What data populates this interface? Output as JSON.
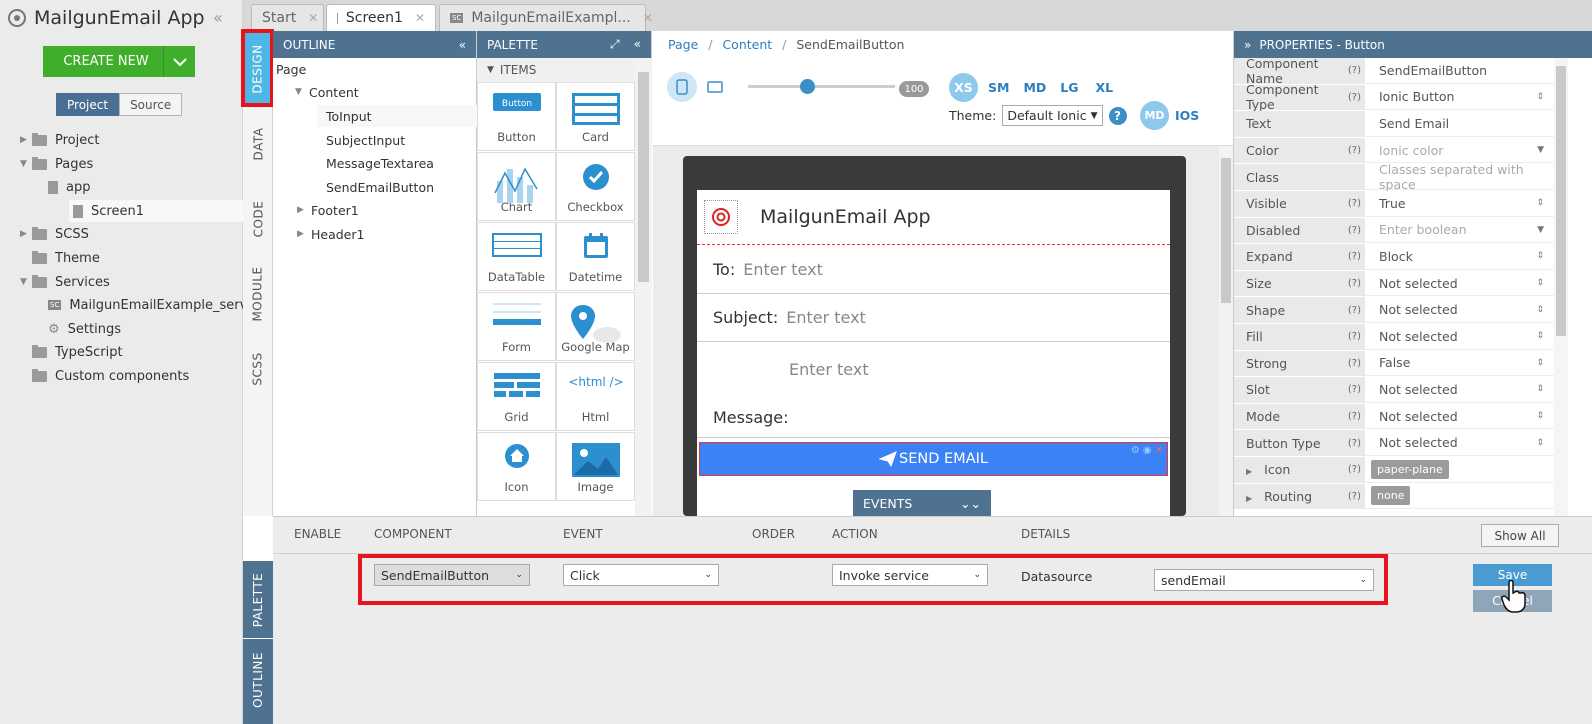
{
  "app": {
    "title": "MailgunEmail App",
    "create_label": "CREATE NEW"
  },
  "left_tabs": {
    "project": "Project",
    "source": "Source"
  },
  "tree": [
    {
      "label": "Project",
      "type": "folder",
      "level": 0,
      "twisty": "▶"
    },
    {
      "label": "Pages",
      "type": "folder",
      "level": 0,
      "twisty": "▼"
    },
    {
      "label": "app",
      "type": "file",
      "level": 1
    },
    {
      "label": "Screen1",
      "type": "file",
      "level": 1,
      "selected": true
    },
    {
      "label": "SCSS",
      "type": "folder",
      "level": 0,
      "twisty": "▶"
    },
    {
      "label": "Theme",
      "type": "folder",
      "level": 0
    },
    {
      "label": "Services",
      "type": "folder",
      "level": 0,
      "twisty": "▼"
    },
    {
      "label": "MailgunEmailExample_service",
      "type": "sc",
      "level": 1
    },
    {
      "label": "Settings",
      "type": "gear",
      "level": 1
    },
    {
      "label": "TypeScript",
      "type": "folder",
      "level": 0
    },
    {
      "label": "Custom components",
      "type": "folder",
      "level": 0
    }
  ],
  "vtabs": [
    "DESIGN",
    "DATA",
    "CODE",
    "MODULE",
    "SCSS"
  ],
  "vtabs_bottom": [
    "PALETTE",
    "OUTLINE"
  ],
  "doc_tabs": [
    {
      "label": "Start"
    },
    {
      "label": "Screen1"
    },
    {
      "label": "MailgunEmailExampl...",
      "badge": "SC"
    }
  ],
  "outline": {
    "title": "OUTLINE",
    "items": [
      "Page",
      "Content",
      "ToInput",
      "SubjectInput",
      "MessageTextarea",
      "SendEmailButton",
      "Footer1",
      "Header1"
    ]
  },
  "palette": {
    "title": "PALETTE",
    "section": "ITEMS",
    "items": [
      "Button",
      "Card",
      "Chart",
      "Checkbox",
      "DataTable",
      "Datetime",
      "Form",
      "Google Map",
      "Grid",
      "Html",
      "Icon",
      "Image"
    ]
  },
  "breadcrumb": {
    "page": "Page",
    "content": "Content",
    "current": "SendEmailButton"
  },
  "toolbar": {
    "zoom": "100",
    "zoom_fraction": 0.4,
    "sizes": [
      "XS",
      "SM",
      "MD",
      "LG",
      "XL"
    ],
    "theme_label": "Theme:",
    "theme_value": "Default Ionic",
    "mode_badge": "MD",
    "platform": "IOS"
  },
  "phone": {
    "title": "MailgunEmail App",
    "to_label": "To:",
    "subject_label": "Subject:",
    "message_label": "Message:",
    "placeholder": "Enter text",
    "send_label": "SEND EMAIL",
    "events_label": "EVENTS"
  },
  "properties": {
    "title": "PROPERTIES - Button",
    "rows": [
      {
        "name": "Component Name",
        "q": "(?)",
        "value": "SendEmailButton"
      },
      {
        "name": "Component Type",
        "q": "(?)",
        "value": "Ionic Button",
        "select": true
      },
      {
        "name": "Text",
        "q": "",
        "value": "Send Email"
      },
      {
        "name": "Color",
        "q": "(?)",
        "value": "Ionic color",
        "dim": true,
        "select": true
      },
      {
        "name": "Class",
        "q": "",
        "value": "Classes separated with space",
        "dim": true
      },
      {
        "name": "Visible",
        "q": "(?)",
        "value": "True",
        "select": true
      },
      {
        "name": "Disabled",
        "q": "(?)",
        "value": "Enter boolean",
        "dim": true,
        "select": true
      },
      {
        "name": "Expand",
        "q": "(?)",
        "value": "Block",
        "select": true
      },
      {
        "name": "Size",
        "q": "(?)",
        "value": "Not selected",
        "select": true
      },
      {
        "name": "Shape",
        "q": "(?)",
        "value": "Not selected",
        "select": true
      },
      {
        "name": "Fill",
        "q": "(?)",
        "value": "Not selected",
        "select": true
      },
      {
        "name": "Strong",
        "q": "(?)",
        "value": "False",
        "select": true
      },
      {
        "name": "Slot",
        "q": "(?)",
        "value": "Not selected",
        "select": true
      },
      {
        "name": "Mode",
        "q": "(?)",
        "value": "Not selected",
        "select": true
      },
      {
        "name": "Button Type",
        "q": "(?)",
        "value": "Not selected",
        "select": true
      },
      {
        "name": "Icon",
        "q": "(?)",
        "chip": "paper-plane",
        "twisty": "▶"
      },
      {
        "name": "Routing",
        "q": "(?)",
        "chip": "none",
        "twisty": "▶"
      }
    ]
  },
  "events": {
    "headers": [
      "ENABLE",
      "COMPONENT",
      "EVENT",
      "ORDER",
      "ACTION",
      "DETAILS"
    ],
    "show_all": "Show All",
    "component": "SendEmailButton",
    "event": "Click",
    "action": "Invoke service",
    "details_label": "Datasource",
    "datasource": "sendEmail",
    "save": "Save",
    "cancel": "Cancel"
  }
}
